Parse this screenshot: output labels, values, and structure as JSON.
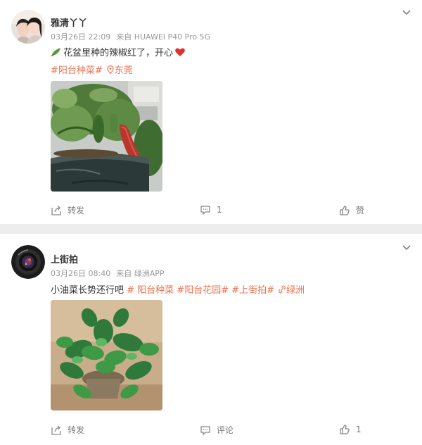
{
  "posts": [
    {
      "user_name": "雅清丫丫",
      "date": "03月26日 22:09",
      "source": "来自 HUAWEI P40 Pro 5G",
      "text": "花盆里种的辣椒红了，开心",
      "topic": "#阳台种菜#",
      "location": "东莞",
      "actions": {
        "repost": "转发",
        "comment": "1",
        "like": "赞"
      },
      "icons": {
        "leaf": "leaf-emoji-icon",
        "heart": "red-heart-emoji-icon",
        "location": "location-pin-icon"
      }
    },
    {
      "user_name": "上街拍",
      "date": "03月26日 08:40",
      "source": "来自 绿洲APP",
      "text_plain": "小油菜长势还行吧 ",
      "topic1": "# 阳台种菜",
      "topic2": "#阳台花园#",
      "topic3": "#上街拍#",
      "oasis_link": "绿洲",
      "actions": {
        "repost": "转发",
        "comment": "评论",
        "like": "1"
      }
    }
  ],
  "colors": {
    "link": "#eb7350",
    "meta": "#999999",
    "divider": "#ededed"
  }
}
